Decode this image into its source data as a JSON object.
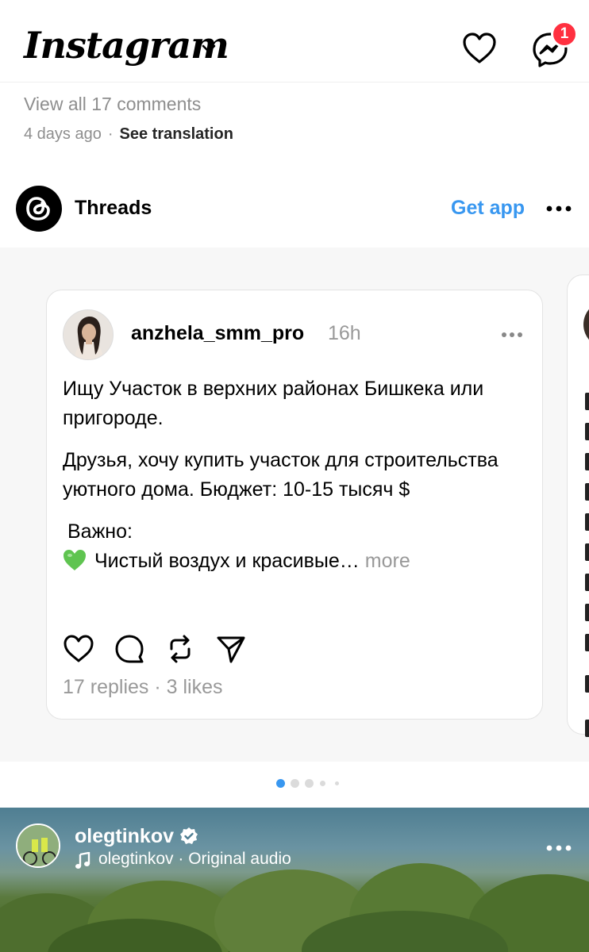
{
  "header": {
    "logo": "Instagram",
    "notifications_badge": "1"
  },
  "previous_post": {
    "view_comments": "View all 17 comments",
    "time_ago": "4 days ago",
    "separator": "·",
    "see_translation": "See translation"
  },
  "threads_bar": {
    "name": "Threads",
    "get_app": "Get app"
  },
  "thread_card": {
    "username": "anzhela_smm_pro",
    "time": "16h",
    "paragraph1": "Ищу Участок в верхних районах Бишкека или пригороде.",
    "paragraph2": "Друзья, хочу купить участок для строительства уютного дома. Бюджет: 10-15 тысяч $",
    "paragraph3": "Важно:",
    "paragraph4": "Чистый воздух и красивые…",
    "more": "more",
    "stats": "17 replies · 3 likes"
  },
  "pager": {
    "active_index": 0,
    "count": 5,
    "active_color": "#3897f0"
  },
  "reel": {
    "username": "olegtinkov",
    "audio": "olegtinkov · Original audio"
  },
  "colors": {
    "accent": "#3897f0",
    "badge": "#ff3040",
    "muted": "#8e8e8e"
  }
}
